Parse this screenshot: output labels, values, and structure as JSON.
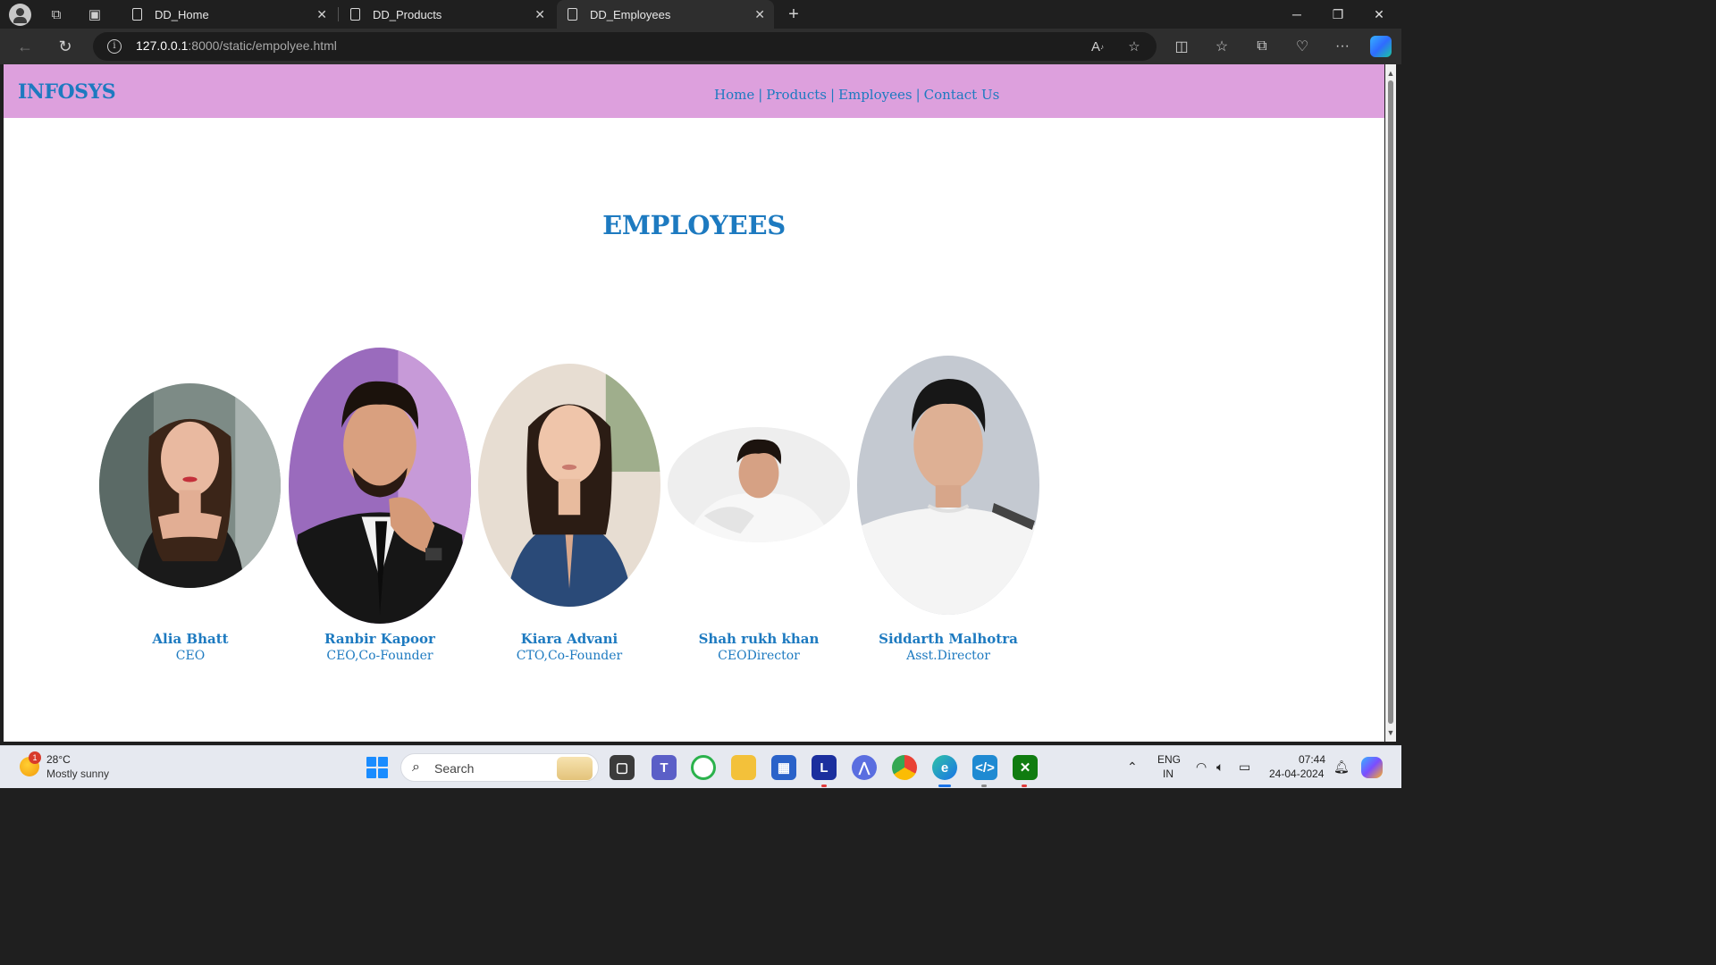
{
  "browser": {
    "tabs": [
      {
        "title": "DD_Home",
        "active": false
      },
      {
        "title": "DD_Products",
        "active": false
      },
      {
        "title": "DD_Employees",
        "active": true
      }
    ],
    "url_host": "127.0.0.1",
    "url_rest": ":8000/static/empolyee.html"
  },
  "site": {
    "brand": "INFOSYS",
    "nav": {
      "home": "Home",
      "products": "Products",
      "employees": "Employees",
      "contact": "Contact Us",
      "separator": "|"
    },
    "heading": "EMPLOYEES",
    "employees": [
      {
        "name": "Alia Bhatt",
        "role": "CEO"
      },
      {
        "name": "Ranbir Kapoor",
        "role": "CEO,Co-Founder"
      },
      {
        "name": "Kiara Advani",
        "role": "CTO,Co-Founder"
      },
      {
        "name": "Shah rukh khan",
        "role": "CEODirector"
      },
      {
        "name": "Siddarth Malhotra",
        "role": "Asst.Director"
      }
    ]
  },
  "taskbar": {
    "weather_temp": "28°C",
    "weather_condition": "Mostly sunny",
    "weather_badge": "1",
    "search_placeholder": "Search",
    "language": "ENG",
    "region": "IN",
    "time": "07:44",
    "date": "24-04-2024"
  },
  "colors": {
    "header_bg": "#dda0dd",
    "accent_text": "#1d7ac0"
  }
}
